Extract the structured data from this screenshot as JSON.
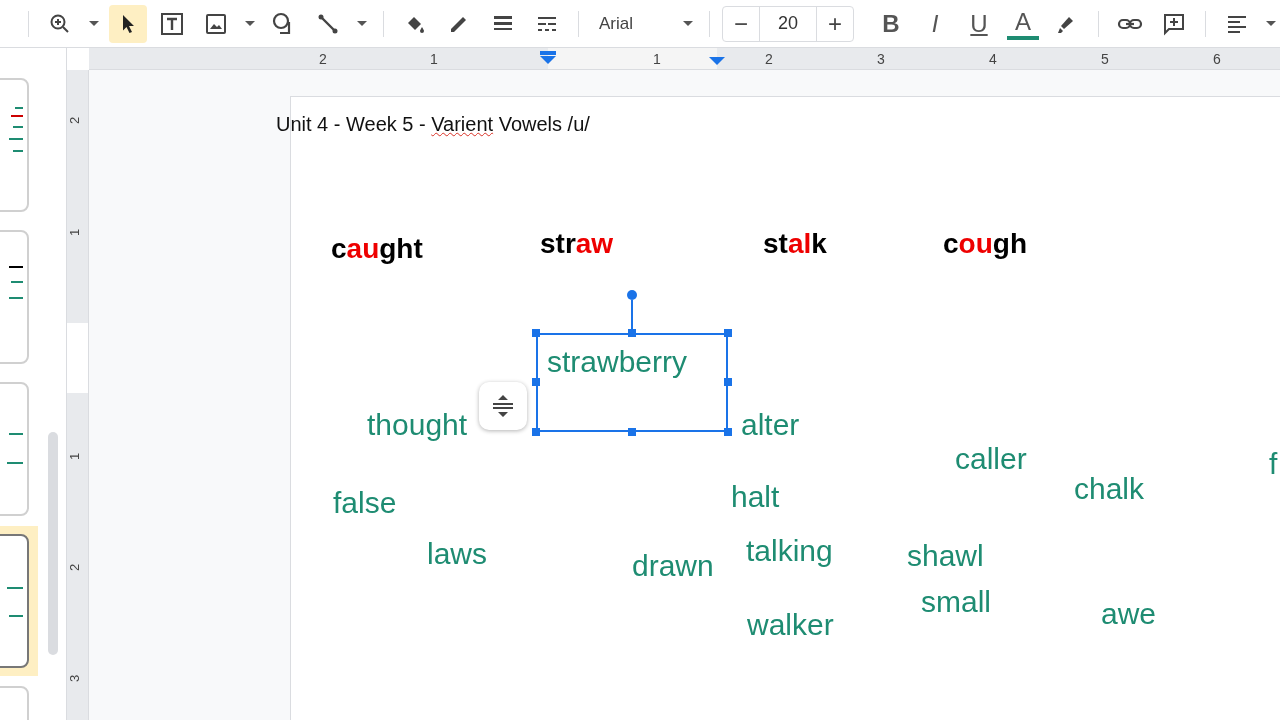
{
  "toolbar": {
    "tools": [
      {
        "kind": "zoom",
        "selected": false,
        "caret": true
      },
      {
        "kind": "select",
        "selected": true,
        "caret": false
      },
      {
        "kind": "textbox",
        "selected": false,
        "caret": false
      },
      {
        "kind": "image",
        "selected": false,
        "caret": true
      },
      {
        "kind": "shape",
        "selected": false,
        "caret": false
      },
      {
        "kind": "line",
        "selected": false,
        "caret": true
      }
    ],
    "styles": [
      {
        "kind": "fill"
      },
      {
        "kind": "border-color"
      },
      {
        "kind": "border-weight"
      },
      {
        "kind": "border-dash"
      }
    ],
    "font": "Arial",
    "font_size": "20",
    "size_minus": "−",
    "size_plus": "+",
    "format": [
      {
        "kind": "bold",
        "label": "B"
      },
      {
        "kind": "italic",
        "label": "I"
      },
      {
        "kind": "underline",
        "label": "U"
      },
      {
        "kind": "text-color",
        "label": "A"
      },
      {
        "kind": "highlight"
      }
    ],
    "insert": [
      {
        "kind": "link"
      },
      {
        "kind": "comment"
      }
    ],
    "align": {
      "kind": "align-left",
      "caret": true
    }
  },
  "rulers": {
    "horizontal": [
      "2",
      "1",
      "1",
      "2",
      "3",
      "4",
      "5",
      "6"
    ],
    "vertical": [
      "2",
      "1",
      "1",
      "2",
      "3"
    ]
  },
  "filmstrip": [
    {
      "selected": false
    },
    {
      "selected": false
    },
    {
      "selected": false
    },
    {
      "selected": true
    },
    {
      "selected": false
    }
  ],
  "slide": {
    "title": [
      {
        "text": "Unit 4 - Week 5 - ",
        "misspelled": false
      },
      {
        "text": "Varient",
        "misspelled": true
      },
      {
        "text": " Vowels /u/",
        "misspelled": false
      }
    ],
    "headers": [
      {
        "parts": [
          {
            "text": "c",
            "highlight": false
          },
          {
            "text": "au",
            "highlight": true
          },
          {
            "text": "ght",
            "highlight": false
          }
        ]
      },
      {
        "parts": [
          {
            "text": "str",
            "highlight": false
          },
          {
            "text": "aw",
            "highlight": true
          }
        ]
      },
      {
        "parts": [
          {
            "text": "st",
            "highlight": false
          },
          {
            "text": "al",
            "highlight": true
          },
          {
            "text": "k",
            "highlight": false
          }
        ]
      },
      {
        "parts": [
          {
            "text": "c",
            "highlight": false
          },
          {
            "text": "ou",
            "highlight": true
          },
          {
            "text": "gh",
            "highlight": false
          }
        ]
      }
    ],
    "words": [
      {
        "text": "strawberry",
        "selected": true
      },
      {
        "text": "thought",
        "selected": false
      },
      {
        "text": "alter",
        "selected": false
      },
      {
        "text": "caller",
        "selected": false
      },
      {
        "text": "f",
        "selected": false
      },
      {
        "text": "false",
        "selected": false
      },
      {
        "text": "halt",
        "selected": false
      },
      {
        "text": "chalk",
        "selected": false
      },
      {
        "text": "laws",
        "selected": false
      },
      {
        "text": "drawn",
        "selected": false
      },
      {
        "text": "talking",
        "selected": false
      },
      {
        "text": "shawl",
        "selected": false
      },
      {
        "text": "walker",
        "selected": false
      },
      {
        "text": "small",
        "selected": false
      },
      {
        "text": "awe",
        "selected": false
      }
    ]
  }
}
